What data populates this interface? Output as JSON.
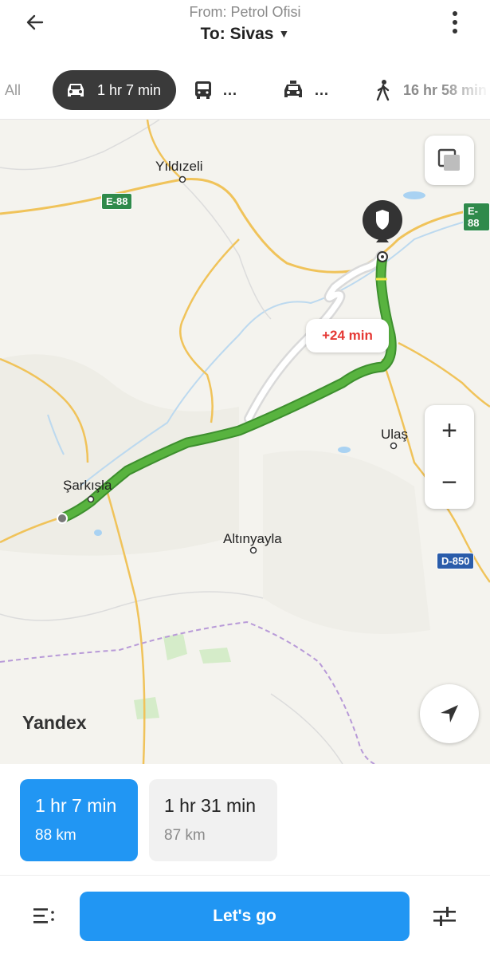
{
  "header": {
    "from": "From: Petrol Ofisi",
    "to": "To: Sivas"
  },
  "modes": {
    "all": "All",
    "car": "1 hr 7 min",
    "bus": "...",
    "taxi": "...",
    "walk": "16 hr 58 min"
  },
  "map": {
    "places": {
      "yildizeli": "Yıldızeli",
      "sarkisla": "Şarkışla",
      "altinyayla": "Altınyayla",
      "ulas": "Ulaş"
    },
    "roads": {
      "e88_left": "E-88",
      "e88_right": "E-88",
      "d850": "D-850"
    },
    "alt_route_delta": "+24 min",
    "logo": "Yandex",
    "zoom_in": "+",
    "zoom_out": "−"
  },
  "routes": [
    {
      "time": "1 hr 7 min",
      "distance": "88 km",
      "selected": true
    },
    {
      "time": "1 hr 31 min",
      "distance": "87 km",
      "selected": false
    }
  ],
  "actions": {
    "go": "Let's go"
  },
  "colors": {
    "accent": "#2196f3",
    "route": "#4caf3a",
    "alt_route": "#e0e0e0",
    "delta_text": "#e53935"
  }
}
